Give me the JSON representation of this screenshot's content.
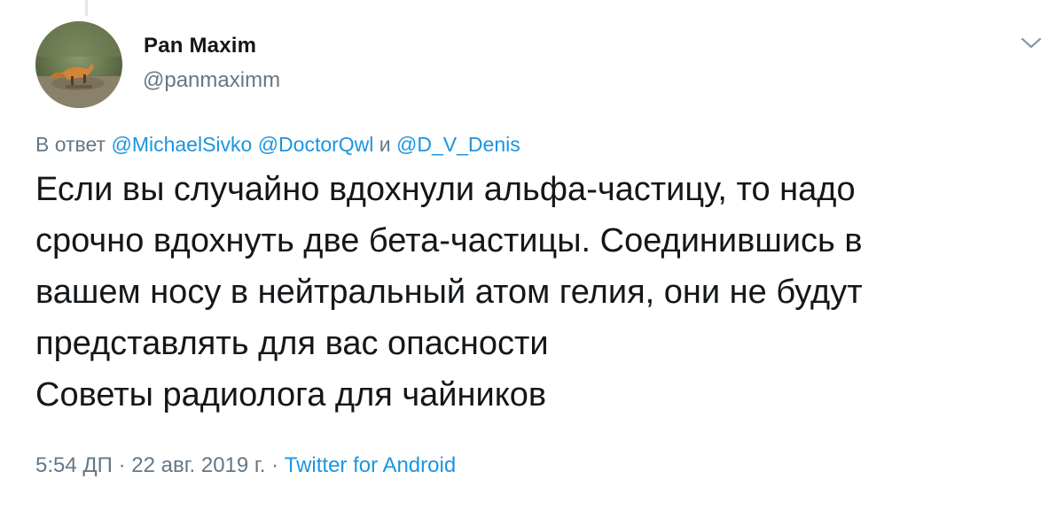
{
  "author": {
    "display_name": "Pan Maxim",
    "handle": "@panmaximm"
  },
  "reply_context": {
    "prefix": "В ответ",
    "mentions": [
      "@MichaelSivko",
      "@DoctorQwl",
      "@D_V_Denis"
    ],
    "conjunction": "и"
  },
  "tweet_text": {
    "lines": [
      "Если вы случайно вдохнули альфа-частицу, то надо",
      "срочно вдохнуть две бета-частицы. Соединившись в",
      "вашем носу в нейтральный атом гелия, они не будут",
      "представлять для вас опасности",
      "Советы радиолога для чайников"
    ]
  },
  "meta": {
    "time": "5:54 ДП",
    "separator": "·",
    "date": "22 авг. 2019 г.",
    "source": "Twitter for Android"
  },
  "icons": {
    "menu": "chevron-down-icon",
    "avatar": "fox-photo-avatar"
  },
  "colors": {
    "text": "#14171a",
    "secondary": "#657786",
    "link": "#1b95e0"
  }
}
